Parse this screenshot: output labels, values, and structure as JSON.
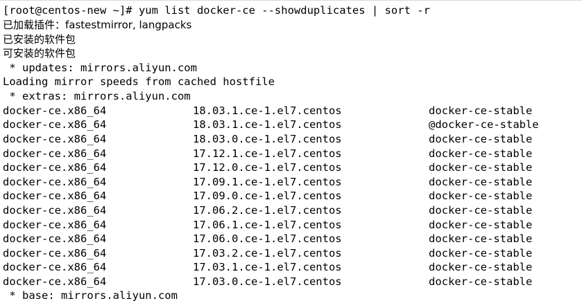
{
  "terminal": {
    "command_line": "[root@centos-new ~]# yum list docker-ce --showduplicates | sort -r",
    "plugins_line": "已加载插件：fastestmirror, langpacks",
    "installed_line": "已安装的软件包",
    "available_line": "可安装的软件包",
    "updates_mirror": " * updates: mirrors.aliyun.com",
    "loading_line": "Loading mirror speeds from cached hostfile",
    "extras_mirror": " * extras: mirrors.aliyun.com",
    "rows": [
      {
        "package": "docker-ce.x86_64",
        "version": "18.03.1.ce-1.el7.centos",
        "repo": "docker-ce-stable"
      },
      {
        "package": "docker-ce.x86_64",
        "version": "18.03.1.ce-1.el7.centos",
        "repo": "@docker-ce-stable"
      },
      {
        "package": "docker-ce.x86_64",
        "version": "18.03.0.ce-1.el7.centos",
        "repo": "docker-ce-stable"
      },
      {
        "package": "docker-ce.x86_64",
        "version": "17.12.1.ce-1.el7.centos",
        "repo": "docker-ce-stable"
      },
      {
        "package": "docker-ce.x86_64",
        "version": "17.12.0.ce-1.el7.centos",
        "repo": "docker-ce-stable"
      },
      {
        "package": "docker-ce.x86_64",
        "version": "17.09.1.ce-1.el7.centos",
        "repo": "docker-ce-stable"
      },
      {
        "package": "docker-ce.x86_64",
        "version": "17.09.0.ce-1.el7.centos",
        "repo": "docker-ce-stable"
      },
      {
        "package": "docker-ce.x86_64",
        "version": "17.06.2.ce-1.el7.centos",
        "repo": "docker-ce-stable"
      },
      {
        "package": "docker-ce.x86_64",
        "version": "17.06.1.ce-1.el7.centos",
        "repo": "docker-ce-stable"
      },
      {
        "package": "docker-ce.x86_64",
        "version": "17.06.0.ce-1.el7.centos",
        "repo": "docker-ce-stable"
      },
      {
        "package": "docker-ce.x86_64",
        "version": "17.03.2.ce-1.el7.centos",
        "repo": "docker-ce-stable"
      },
      {
        "package": "docker-ce.x86_64",
        "version": "17.03.1.ce-1.el7.centos",
        "repo": "docker-ce-stable"
      },
      {
        "package": "docker-ce.x86_64",
        "version": "17.03.0.ce-1.el7.centos",
        "repo": "docker-ce-stable"
      }
    ],
    "base_mirror": " * base: mirrors.aliyun.com"
  }
}
